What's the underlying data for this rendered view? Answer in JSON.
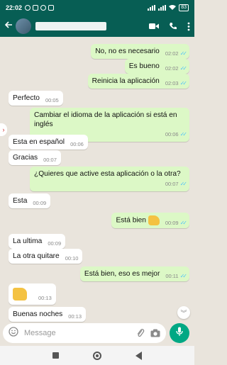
{
  "status_bar": {
    "time": "22:02",
    "battery": "83"
  },
  "header": {
    "contact_name": ""
  },
  "messages": [
    {
      "dir": "out",
      "text": "No, no es necesario",
      "time": "02:02",
      "read": true
    },
    {
      "dir": "out",
      "text": "Es bueno",
      "time": "02:02",
      "read": true
    },
    {
      "dir": "out",
      "text": "Reinicia la aplicación",
      "time": "02:03",
      "read": true
    },
    {
      "dir": "in",
      "text": "Perfecto",
      "time": "00:05"
    },
    {
      "dir": "out",
      "text": "Cambiar el idioma de la aplicación si está en inglés",
      "time": "00:06",
      "read": true
    },
    {
      "dir": "in",
      "text": "Esta en español",
      "time": "00:06"
    },
    {
      "dir": "in",
      "text": "Gracias",
      "time": "00:07"
    },
    {
      "dir": "out",
      "text": "¿Quieres que active esta aplicación o la otra?",
      "time": "00:07",
      "read": true
    },
    {
      "dir": "in",
      "text": "Esta",
      "time": "00:09"
    },
    {
      "dir": "out",
      "text": "Está bien",
      "emoji": "thumbs-up",
      "time": "00:09",
      "read": true
    },
    {
      "dir": "in",
      "text": "La ultima",
      "time": "00:09"
    },
    {
      "dir": "in",
      "text": "La otra quitare",
      "time": "00:10"
    },
    {
      "dir": "out",
      "text": "Está bien, eso es mejor",
      "time": "00:11",
      "read": true
    },
    {
      "dir": "in",
      "text": "",
      "emoji": "thumbs-up",
      "time": "00:13"
    },
    {
      "dir": "in",
      "text": "Buenas noches",
      "time": "00:13"
    }
  ],
  "input": {
    "placeholder": "Message"
  },
  "icons": {
    "back": "arrow-left-icon",
    "video": "video-camera-icon",
    "call": "phone-icon",
    "menu": "more-vert-icon",
    "emoji": "smiley-icon",
    "attach": "paperclip-icon",
    "camera": "camera-icon",
    "mic": "microphone-icon"
  },
  "colors": {
    "header": "#075e54",
    "outgoing_bubble": "#dcf8c6",
    "incoming_bubble": "#ffffff",
    "read_ticks": "#4fc3f7",
    "mic_button": "#00a884",
    "chat_bg": "#e9e4dc"
  }
}
